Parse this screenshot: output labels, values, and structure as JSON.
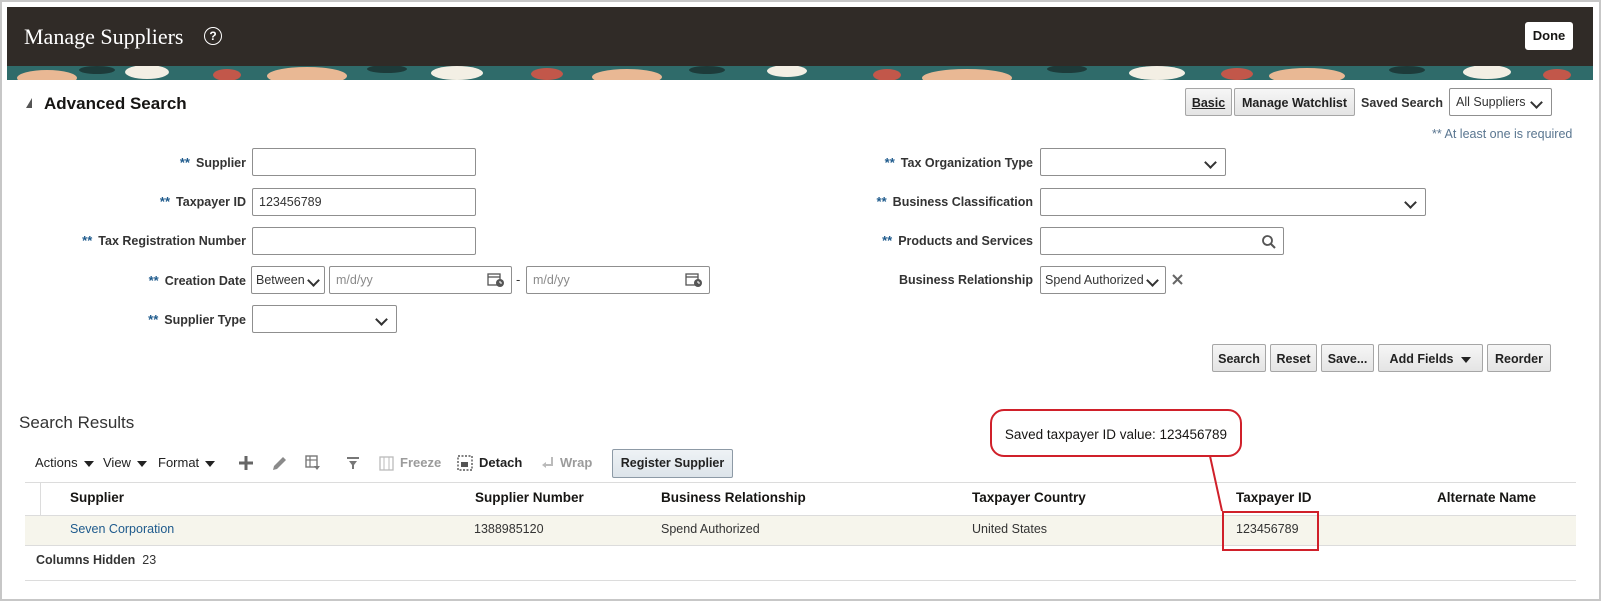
{
  "header": {
    "title": "Manage Suppliers",
    "done_label": "Done"
  },
  "advanced_search": {
    "title": "Advanced Search",
    "basic_label": "Basic",
    "manage_watchlist_label": "Manage Watchlist",
    "saved_search_label": "Saved Search",
    "saved_search_value": "All Suppliers",
    "required_note": "** At least one is required",
    "req_marker": "**",
    "fields": {
      "supplier_label": "Supplier",
      "taxpayer_id_label": "Taxpayer ID",
      "taxpayer_id_value": "123456789",
      "tax_registration_label": "Tax Registration Number",
      "creation_date_label": "Creation Date",
      "creation_date_operator": "Between",
      "date_placeholder_1": "m/d/yy",
      "date_separator": "-",
      "date_placeholder_2": "m/d/yy",
      "supplier_type_label": "Supplier Type",
      "tax_org_type_label": "Tax Organization Type",
      "business_classification_label": "Business Classification",
      "products_services_label": "Products and Services",
      "business_relationship_label": "Business Relationship",
      "business_relationship_value": "Spend Authorized"
    },
    "buttons": {
      "search": "Search",
      "reset": "Reset",
      "save": "Save...",
      "add_fields": "Add Fields",
      "reorder": "Reorder"
    }
  },
  "results": {
    "title": "Search Results",
    "toolbar": {
      "actions": "Actions",
      "view": "View",
      "format": "Format",
      "freeze": "Freeze",
      "detach": "Detach",
      "wrap": "Wrap",
      "register_supplier": "Register Supplier"
    },
    "columns": [
      "Supplier",
      "Supplier Number",
      "Business Relationship",
      "Taxpayer Country",
      "Taxpayer ID",
      "Alternate Name"
    ],
    "rows": [
      {
        "supplier": "Seven Corporation",
        "supplier_number": "1388985120",
        "business_relationship": "Spend Authorized",
        "taxpayer_country": "United States",
        "taxpayer_id": "123456789",
        "alternate_name": ""
      }
    ],
    "columns_hidden_label": "Columns Hidden",
    "columns_hidden_count": "23"
  },
  "callout": {
    "text": "Saved taxpayer ID value: 123456789"
  },
  "colors": {
    "header_bg": "#302b27",
    "link": "#1e5a8c",
    "callout_red": "#d0202a",
    "row_highlight": "#f6f5ec"
  }
}
